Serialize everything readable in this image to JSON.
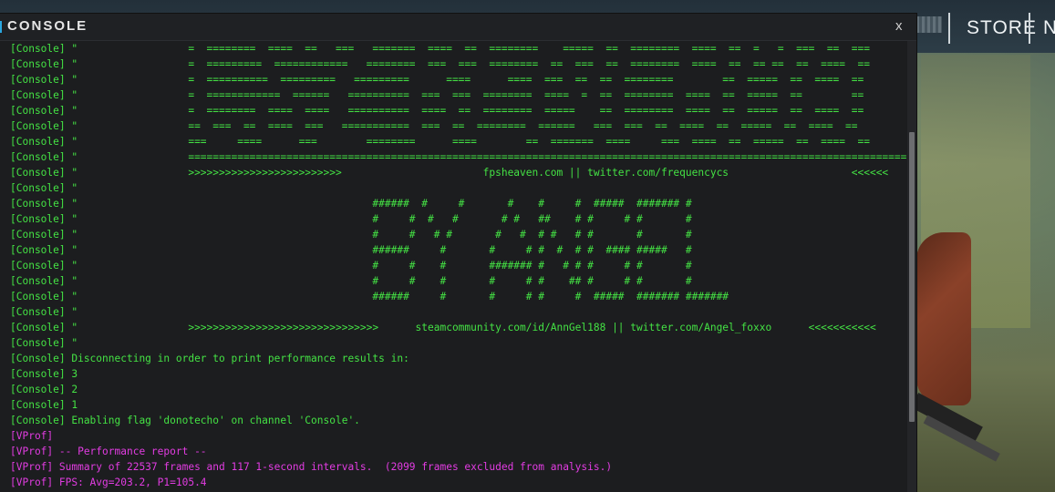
{
  "window": {
    "title": "CONSOLE",
    "close_label": "x"
  },
  "topbar": {
    "store_label": "STORE",
    "next_label": "N"
  },
  "log_lines": [
    {
      "kind": "console",
      "text": "[Console] \"                  =  ========  ====  ==   ===   =======  ====  ==  ========    =====  ==  ========  ====  ==  =   =  ===  ==  ==="
    },
    {
      "kind": "console",
      "text": "[Console] \"                  =  =========  ============   ========  ===  ===  ========  ==  ===  ==  ========  ====  ==  == ==  ==  ====  =="
    },
    {
      "kind": "console",
      "text": "[Console] \"                  =  ==========  =========   =========      ====      ====  ===  ==  ==  ========        ==  =====  ==  ====  =="
    },
    {
      "kind": "console",
      "text": "[Console] \"                  =  ============  ======   ==========  ===  ===  ========  ====  =  ==  ========  ====  ==  =====  ==        =="
    },
    {
      "kind": "console",
      "text": "[Console] \"                  =  ========  ====  ====   ==========  ====  ==  ========  =====    ==  ========  ====  ==  =====  ==  ====  =="
    },
    {
      "kind": "console",
      "text": "[Console] \"                  ==  ===  ==  ====  ===   ===========  ===  ==  ========  ======   ===  ===  ==  ====  ==  =====  ==  ====  =="
    },
    {
      "kind": "console",
      "text": "[Console] \"                  ===     ====      ===        ========      ====        ==  =======  ====     ===  ====  ==  =====  ==  ====  =="
    },
    {
      "kind": "console",
      "text": "[Console] \"                  ====================================================================================================================="
    },
    {
      "kind": "console",
      "text": "[Console] \"                  >>>>>>>>>>>>>>>>>>>>>>>>>                       fpsheaven.com || twitter.com/frequencycs                    <<<<<<"
    },
    {
      "kind": "console",
      "text": "[Console] \""
    },
    {
      "kind": "console",
      "text": "[Console] \"                                                ######  #     #       #    #     #  #####  ####### #"
    },
    {
      "kind": "console",
      "text": "[Console] \"                                                #     #  #   #       # #   ##    # #     # #       #"
    },
    {
      "kind": "console",
      "text": "[Console] \"                                                #     #   # #       #   #  # #   # #       #       #"
    },
    {
      "kind": "console",
      "text": "[Console] \"                                                ######     #       #     # #  #  # #  #### #####   #"
    },
    {
      "kind": "console",
      "text": "[Console] \"                                                #     #    #       ####### #   # # #     # #       #"
    },
    {
      "kind": "console",
      "text": "[Console] \"                                                #     #    #       #     # #    ## #     # #       #"
    },
    {
      "kind": "console",
      "text": "[Console] \"                                                ######     #       #     # #     #  #####  ####### #######"
    },
    {
      "kind": "console",
      "text": "[Console] \""
    },
    {
      "kind": "console",
      "text": "[Console] \"                  >>>>>>>>>>>>>>>>>>>>>>>>>>>>>>>      steamcommunity.com/id/AnnGel188 || twitter.com/Angel_foxxo      <<<<<<<<<<<"
    },
    {
      "kind": "console",
      "text": "[Console] \""
    },
    {
      "kind": "console",
      "text": "[Console] Disconnecting in order to print performance results in:"
    },
    {
      "kind": "console",
      "text": "[Console] 3"
    },
    {
      "kind": "console",
      "text": "[Console] 2"
    },
    {
      "kind": "console",
      "text": "[Console] 1"
    },
    {
      "kind": "console",
      "text": "[Console] Enabling flag 'donotecho' on channel 'Console'."
    },
    {
      "kind": "vprof",
      "text": "[VProf]"
    },
    {
      "kind": "vprof",
      "text": "[VProf] -- Performance report --"
    },
    {
      "kind": "vprof",
      "text": "[VProf] Summary of 22537 frames and 117 1-second intervals.  (2099 frames excluded from analysis.)"
    },
    {
      "kind": "vprof",
      "text": "[VProf] FPS: Avg=203.2, P1=105.4"
    }
  ],
  "colors": {
    "console_text": "#44e244",
    "vprof_text": "#e23ce2",
    "accent": "#2aa7e0"
  },
  "icons": {
    "close": "close-icon"
  }
}
